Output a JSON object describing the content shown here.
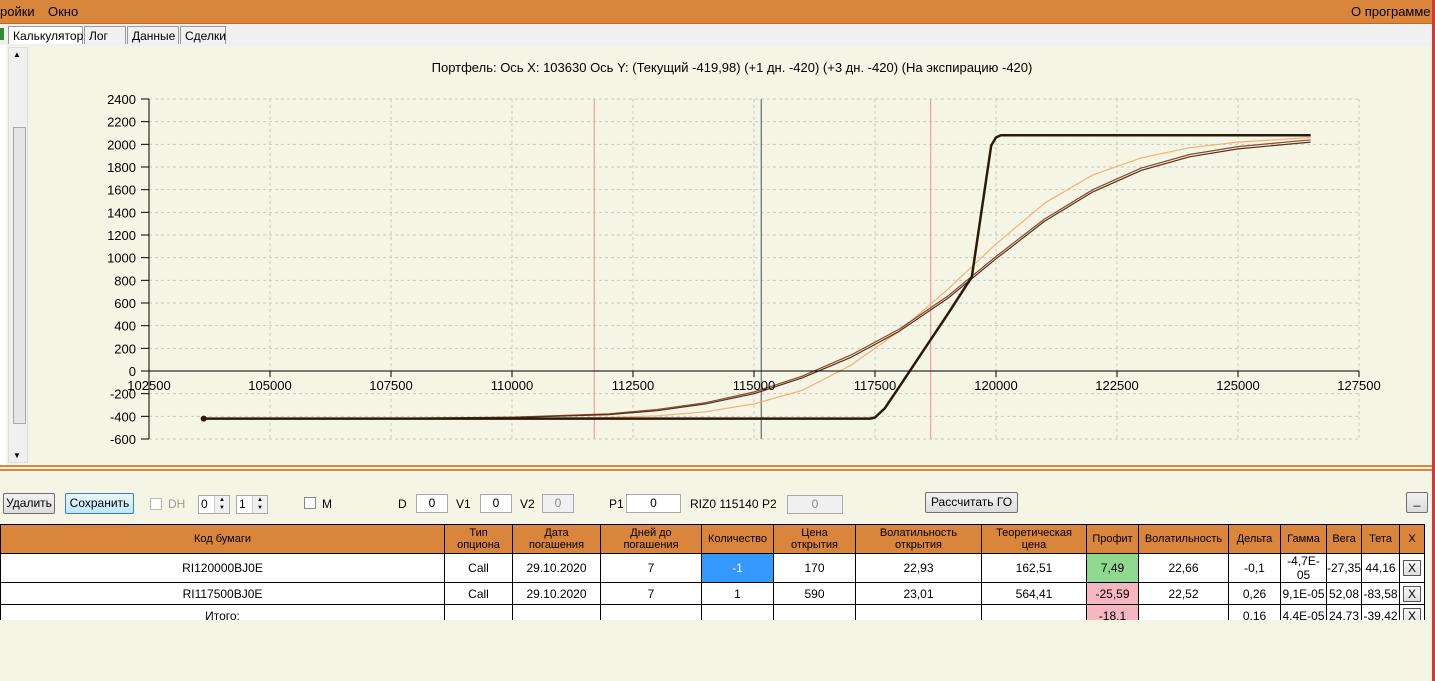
{
  "menu": {
    "settings_partial": "ройки",
    "window": "Окно",
    "about": "О программе"
  },
  "tabs": [
    "Калькулятор",
    "Лог",
    "Данные",
    "Сделки"
  ],
  "chart_title": "Портфель:  Ось X: 103630 Ось Y:  (Текущий -419,98)  (+1 дн. -420)  (+3 дн. -420)  (На экспирацию -420)",
  "chart_data": {
    "type": "line",
    "xlim": [
      102500,
      127500
    ],
    "ylim": [
      -600,
      2400
    ],
    "x_ticks": [
      102500,
      105000,
      107500,
      110000,
      112500,
      115000,
      117500,
      120000,
      122500,
      125000,
      127500
    ],
    "y_ticks": [
      2400,
      2200,
      2000,
      1800,
      1600,
      1400,
      1200,
      1000,
      800,
      600,
      400,
      200,
      0,
      -200,
      -400,
      -600
    ],
    "grid": true,
    "vertical_lines": [
      {
        "x": 111700,
        "color": "#f0a0a0"
      },
      {
        "x": 115150,
        "color": "#607070"
      },
      {
        "x": 118650,
        "color": "#f0a0a0"
      }
    ],
    "series": [
      {
        "color": "#2b1a0a",
        "width": 2.5,
        "x": [
          103630,
          110000,
          115000,
          117400,
          117500,
          117700,
          118000,
          118500,
          119000,
          119500,
          119900,
          120000,
          120100,
          126500
        ],
        "y": [
          -420,
          -420,
          -420,
          -420,
          -410,
          -330,
          -140,
          180,
          500,
          830,
          1990,
          2060,
          2080,
          2080
        ]
      },
      {
        "color": "#5a2e1a",
        "width": 1.2,
        "x": [
          103630,
          106000,
          108000,
          110000,
          112000,
          113000,
          114000,
          115000,
          116000,
          117000,
          118000,
          119000,
          120000,
          121000,
          122000,
          123000,
          124000,
          125000,
          126500
        ],
        "y": [
          -420,
          -419,
          -417,
          -410,
          -385,
          -350,
          -290,
          -200,
          -60,
          120,
          350,
          640,
          990,
          1320,
          1580,
          1770,
          1890,
          1960,
          2020
        ]
      },
      {
        "color": "#8a4a2a",
        "width": 1.2,
        "x": [
          103630,
          106000,
          108000,
          110000,
          112000,
          113000,
          114000,
          115000,
          116000,
          117000,
          118000,
          119000,
          120000,
          121000,
          122000,
          123000,
          124000,
          125000,
          126500
        ],
        "y": [
          -420,
          -419,
          -416,
          -408,
          -378,
          -340,
          -280,
          -185,
          -45,
          140,
          370,
          660,
          1010,
          1340,
          1600,
          1790,
          1910,
          1980,
          2040
        ]
      },
      {
        "color": "#f5b070",
        "width": 1.2,
        "x": [
          103630,
          106000,
          108000,
          110000,
          112000,
          113000,
          114000,
          115000,
          116000,
          117000,
          118000,
          119000,
          120000,
          121000,
          122000,
          123000,
          124000,
          125000,
          126500
        ],
        "y": [
          -420,
          -420,
          -420,
          -418,
          -410,
          -395,
          -360,
          -290,
          -170,
          50,
          350,
          720,
          1120,
          1480,
          1730,
          1880,
          1970,
          2020,
          2060
        ]
      }
    ],
    "start_marker": {
      "x": 103630,
      "y": -420
    }
  },
  "toolbar": {
    "delete": "Удалить",
    "save": "Сохранить",
    "dh": "DH",
    "spin1": "0",
    "spin2": "1",
    "m": "M",
    "d_label": "D",
    "d_value": "0",
    "v1_label": "V1",
    "v1_value": "0",
    "v2_label": "V2",
    "v2_value": "0",
    "p1_label": "P1",
    "p1_value": "0",
    "riz": "RIZ0 115140",
    "p2_label": "P2",
    "p2_value": "0",
    "calc_go": "Рассчитать ГО",
    "minimize": "_"
  },
  "grid": {
    "headers": [
      "Код бумаги",
      "Тип\nопциона",
      "Дата\nпогашения",
      "Дней до\nпогашения",
      "Количество",
      "Цена\nоткрытия",
      "Волатильность\nоткрытия",
      "Теоретическая\nцена",
      "Профит",
      "Волатильность",
      "Дельта",
      "Гамма",
      "Вега",
      "Тета",
      "X"
    ],
    "rows": [
      [
        "RI120000BJ0E",
        "Call",
        "29.10.2020",
        "7",
        "-1",
        "170",
        "22,93",
        "162,51",
        "7,49",
        "22,66",
        "-0,1",
        "-4,7E-05",
        "-27,35",
        "44,16",
        "X"
      ],
      [
        "RI117500BJ0E",
        "Call",
        "29.10.2020",
        "7",
        "1",
        "590",
        "23,01",
        "564,41",
        "-25,59",
        "22,52",
        "0,26",
        "9,1E-05",
        "52,08",
        "-83,58",
        "X"
      ],
      [
        "Итого:",
        "",
        "",
        "",
        "",
        "",
        "",
        "",
        "-18,1",
        "",
        "0,16",
        "4,4E-05",
        "24,73",
        "-39,42",
        "X"
      ]
    ]
  }
}
